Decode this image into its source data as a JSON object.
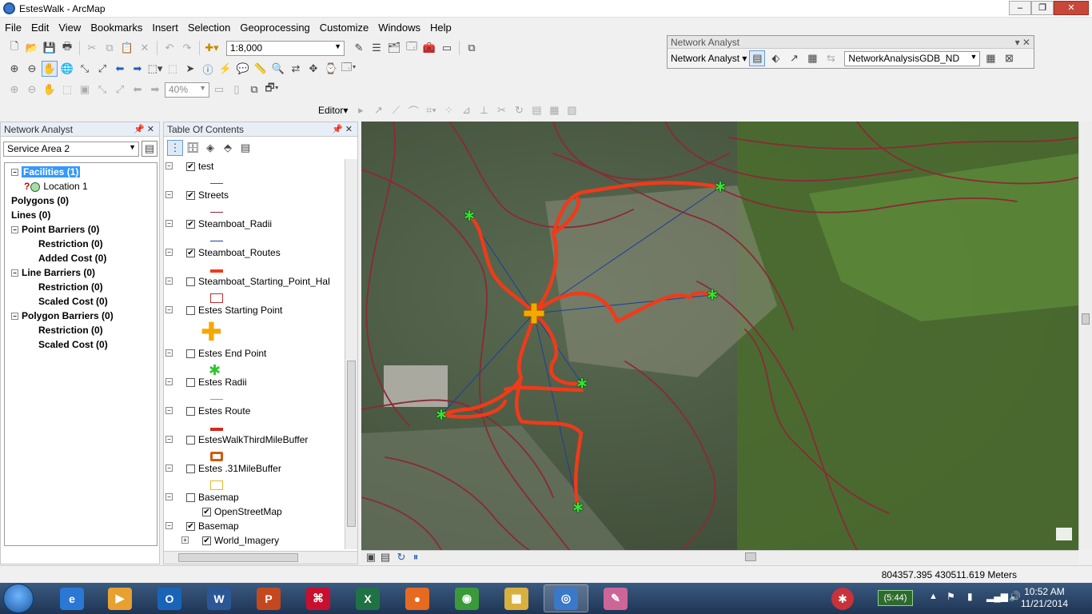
{
  "window": {
    "title": "EstesWalk - ArcMap",
    "minimize": "–",
    "maximize": "❐",
    "close": "✕"
  },
  "menu": [
    "File",
    "Edit",
    "View",
    "Bookmarks",
    "Insert",
    "Selection",
    "Geoprocessing",
    "Customize",
    "Windows",
    "Help"
  ],
  "standard_toolbar": {
    "scale": "1:8,000"
  },
  "zoom_toolbar": {
    "zoom_percent": "40%"
  },
  "editor_toolbar": {
    "editor_label": "Editor"
  },
  "network_analyst_toolbar": {
    "title": "Network Analyst",
    "menu_label": "Network Analyst",
    "dataset": "NetworkAnalysisGDB_ND"
  },
  "network_analyst_window": {
    "title": "Network Analyst",
    "layer_selector": "Service Area 2",
    "tree": [
      {
        "label": "Facilities (1)",
        "level": 0,
        "expander": "⊟",
        "selected": true
      },
      {
        "label": "Location 1",
        "level": 1,
        "expander": "",
        "selected": false
      },
      {
        "label": "Polygons (0)",
        "level": 0,
        "expander": "",
        "selected": false
      },
      {
        "label": "Lines (0)",
        "level": 0,
        "expander": "",
        "selected": false
      },
      {
        "label": "Point Barriers (0)",
        "level": 0,
        "expander": "⊟",
        "selected": false
      },
      {
        "label": "Restriction (0)",
        "level": 2,
        "expander": "",
        "selected": false
      },
      {
        "label": "Added Cost (0)",
        "level": 2,
        "expander": "",
        "selected": false
      },
      {
        "label": "Line Barriers (0)",
        "level": 0,
        "expander": "⊟",
        "selected": false
      },
      {
        "label": "Restriction (0)",
        "level": 2,
        "expander": "",
        "selected": false
      },
      {
        "label": "Scaled Cost (0)",
        "level": 2,
        "expander": "",
        "selected": false
      },
      {
        "label": "Polygon Barriers (0)",
        "level": 0,
        "expander": "⊟",
        "selected": false
      },
      {
        "label": "Restriction (0)",
        "level": 2,
        "expander": "",
        "selected": false
      },
      {
        "label": "Scaled Cost (0)",
        "level": 2,
        "expander": "",
        "selected": false
      }
    ]
  },
  "table_of_contents": {
    "title": "Table Of Contents",
    "layers": [
      {
        "name": "test",
        "checked": true,
        "symbol": "line-purple"
      },
      {
        "name": "Streets",
        "checked": true,
        "symbol": "line-darkred"
      },
      {
        "name": "Steamboat_Radii",
        "checked": true,
        "symbol": "line-blue"
      },
      {
        "name": "Steamboat_Routes",
        "checked": true,
        "symbol": "line-red-thick"
      },
      {
        "name": "Steamboat_Starting_Point_Hal",
        "checked": false,
        "symbol": "poly-red-outline"
      },
      {
        "name": "Estes Starting Point",
        "checked": false,
        "symbol": "cross-orange"
      },
      {
        "name": "Estes End Point",
        "checked": false,
        "symbol": "star-green"
      },
      {
        "name": "Estes Radii",
        "checked": false,
        "symbol": "line-gray"
      },
      {
        "name": "Estes Route",
        "checked": false,
        "symbol": "line-red"
      },
      {
        "name": "EstesWalkThirdMileBuffer",
        "checked": false,
        "symbol": "poly-orange-thick"
      },
      {
        "name": "Estes .31MileBuffer",
        "checked": false,
        "symbol": "poly-yellow"
      },
      {
        "name": "Basemap",
        "checked": false,
        "symbol": "group"
      },
      {
        "name": "OpenStreetMap",
        "checked": true,
        "symbol": "sublayer"
      },
      {
        "name": "Basemap",
        "checked": true,
        "symbol": "group"
      },
      {
        "name": "World_Imagery",
        "checked": true,
        "symbol": "sublayer-expand"
      }
    ]
  },
  "map": {
    "route_color": "#f03a1a",
    "street_color": "#8a2a35",
    "radii_color": "#1c3f99",
    "endpoint_color": "#3be03b",
    "start_color": "#f5a800"
  },
  "status": {
    "coordinates": "804357.395  430511.619 Meters"
  },
  "taskbar": {
    "battery": "(5:44)",
    "time": "10:52 AM",
    "date": "11/21/2014",
    "apps": [
      {
        "name": "internet-explorer",
        "label": "e",
        "color": "#2a78d4"
      },
      {
        "name": "media-player",
        "label": "▶",
        "color": "#e8a030"
      },
      {
        "name": "outlook",
        "label": "O",
        "color": "#1a64b8"
      },
      {
        "name": "word",
        "label": "W",
        "color": "#2b5797"
      },
      {
        "name": "powerpoint",
        "label": "P",
        "color": "#c4481f"
      },
      {
        "name": "acrobat",
        "label": "⌘",
        "color": "#c8102e"
      },
      {
        "name": "excel",
        "label": "X",
        "color": "#1f7244"
      },
      {
        "name": "firefox",
        "label": "●",
        "color": "#e66a1f"
      },
      {
        "name": "chrome",
        "label": "◉",
        "color": "#3a9a3a"
      },
      {
        "name": "file-explorer",
        "label": "▦",
        "color": "#d8b040"
      },
      {
        "name": "arcmap",
        "label": "◎",
        "color": "#3c78c8"
      },
      {
        "name": "paint",
        "label": "✎",
        "color": "#cc6699"
      }
    ]
  }
}
